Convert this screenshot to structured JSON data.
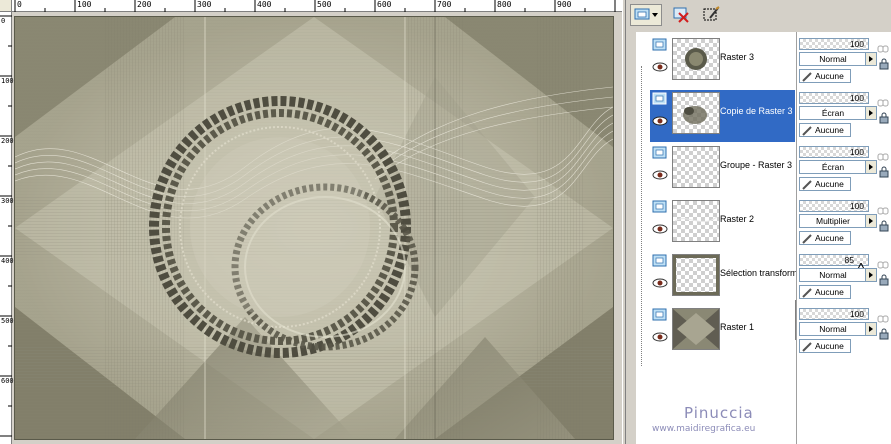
{
  "rulers": {
    "horizontal_labels": [
      "0",
      "100",
      "200",
      "300",
      "400",
      "500",
      "600",
      "700",
      "800",
      "900"
    ],
    "vertical_labels": [
      "0",
      "100",
      "200",
      "300",
      "400",
      "500",
      "600"
    ]
  },
  "layers": [
    {
      "name": "Raster 3",
      "opacity": "100",
      "blend": "Normal",
      "mask": "Aucune",
      "selected": false
    },
    {
      "name": "Copie de Raster 3",
      "opacity": "100",
      "blend": "Écran",
      "mask": "Aucune",
      "selected": true
    },
    {
      "name": "Groupe - Raster 3",
      "opacity": "100",
      "blend": "Écran",
      "mask": "Aucune",
      "selected": false
    },
    {
      "name": "Raster 2",
      "opacity": "100",
      "blend": "Multiplier",
      "mask": "Aucune",
      "selected": false
    },
    {
      "name": "Sélection transform",
      "opacity": "85",
      "blend": "Normal",
      "mask": "Aucune",
      "selected": false
    },
    {
      "name": "Raster 1",
      "opacity": "100",
      "blend": "Normal",
      "mask": "Aucune",
      "selected": false
    }
  ],
  "watermark": {
    "title": "Pinuccia",
    "url": "www.maidiregrafica.eu"
  },
  "colors": {
    "selection": "#316ac5",
    "panel": "#d4d0c8",
    "artwork_base": "#b9b6a3",
    "watermark": "#8c8cb8"
  }
}
